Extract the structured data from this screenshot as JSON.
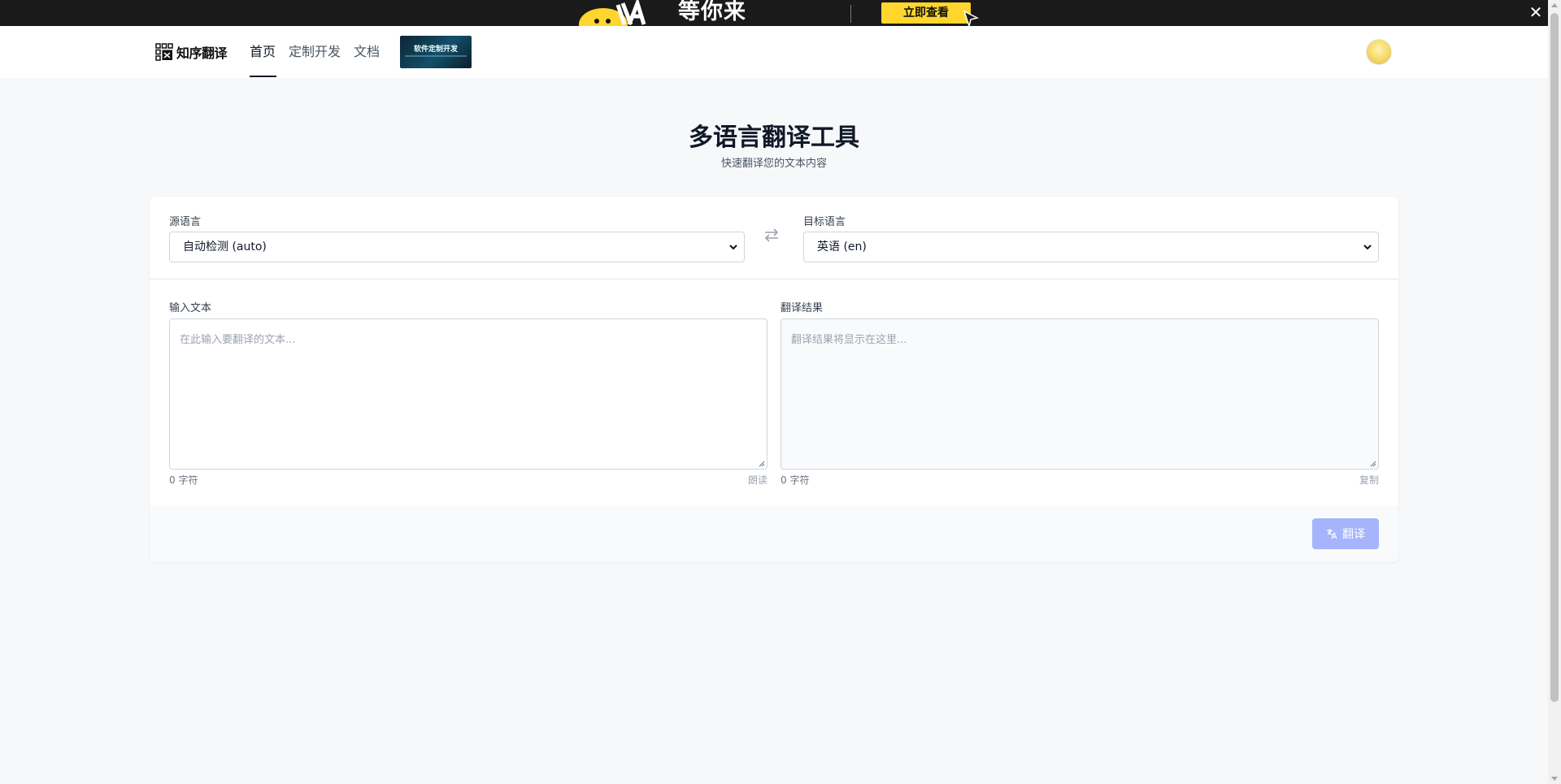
{
  "banner": {
    "slogan": "等你来",
    "cta_label": "立即查看",
    "close_glyph": "✕",
    "art_icon": "mascot-icon",
    "cursor_icon": "cursor-arrow-icon"
  },
  "header": {
    "logo_text": "知序翻译",
    "logo_icon": "grid-logo-icon",
    "nav": [
      {
        "label": "首页",
        "active": true
      },
      {
        "label": "定制开发",
        "active": false
      },
      {
        "label": "文档",
        "active": false
      }
    ],
    "ad_text": "软件定制开发",
    "avatar_icon": "user-avatar-icon"
  },
  "hero": {
    "title": "多语言翻译工具",
    "subtitle": "快速翻译您的文本内容"
  },
  "languages": {
    "source_label": "源语言",
    "source_value": "自动检测 (auto)",
    "target_label": "目标语言",
    "target_value": "英语 (en)",
    "swap_icon": "swap-arrows-icon"
  },
  "input": {
    "label": "输入文本",
    "placeholder": "在此输入要翻译的文本...",
    "char_count": "0 字符",
    "action": "朗读"
  },
  "output": {
    "label": "翻译结果",
    "placeholder": "翻译结果将显示在这里...",
    "char_count": "0 字符",
    "action": "复制"
  },
  "footer": {
    "translate_label": "翻译",
    "translate_icon": "translate-icon"
  },
  "colors": {
    "banner_bg": "#1a1a1a",
    "banner_cta": "#ffd52e",
    "page_bg": "#f7f8fa",
    "button_disabled": "#a5b4fc"
  }
}
